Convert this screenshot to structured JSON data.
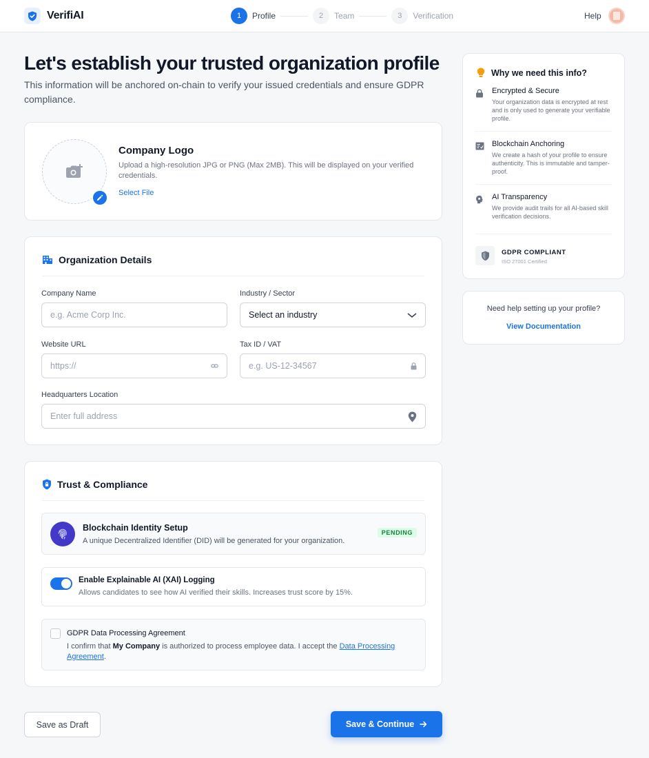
{
  "brand": {
    "name": "VerifiAI"
  },
  "stepper": [
    {
      "num": "1",
      "label": "Profile"
    },
    {
      "num": "2",
      "label": "Team"
    },
    {
      "num": "3",
      "label": "Verification"
    }
  ],
  "header": {
    "help": "Help"
  },
  "hero": {
    "title": "Let's establish your trusted organization profile",
    "subtitle": "This information will be anchored on-chain to verify your issued credentials and ensure GDPR compliance."
  },
  "logo": {
    "title": "Company Logo",
    "description": "Upload a high-resolution JPG or PNG (Max 2MB). This will be displayed on your verified credentials.",
    "link": "Select File"
  },
  "org": {
    "title": "Organization Details",
    "company_name": {
      "label": "Company Name",
      "placeholder": "e.g. Acme Corp Inc."
    },
    "industry": {
      "label": "Industry / Sector",
      "value": "Select an industry"
    },
    "website": {
      "label": "Website URL",
      "placeholder": "https://"
    },
    "tax": {
      "label": "Tax ID / VAT",
      "placeholder": "e.g. US-12-34567"
    },
    "hq": {
      "label": "Headquarters Location",
      "placeholder": "Enter full address"
    }
  },
  "trust": {
    "title": "Trust & Compliance",
    "blockchain": {
      "title": "Blockchain Identity Setup",
      "description": "A unique Decentralized Identifier (DID) will be generated for your organization.",
      "badge": "PENDING"
    },
    "xai": {
      "title": "Enable Explainable AI (XAI) Logging",
      "description": "Allows candidates to see how AI verified their skills. Increases trust score by 15%.",
      "enabled": true
    },
    "gdpr": {
      "title": "GDPR Data Processing Agreement",
      "text_before": "I confirm that ",
      "company": "My Company",
      "text_mid": " is authorized to process employee data. I accept the ",
      "link": "Data Processing Agreement",
      "text_after": ".",
      "checked": false
    }
  },
  "actions": {
    "draft": "Save as Draft",
    "continue": "Save & Continue"
  },
  "info": {
    "title": "Why we need this info?",
    "items": [
      {
        "icon": "lock-icon",
        "title": "Encrypted & Secure",
        "description": "Your organization data is encrypted at rest and is only used to generate your verifiable profile."
      },
      {
        "icon": "ledger-icon",
        "title": "Blockchain Anchoring",
        "description": "We create a hash of your profile to ensure authenticity. This is immutable and tamper-proof."
      },
      {
        "icon": "brain-icon",
        "title": "AI Transparency",
        "description": "We provide audit trails for all AI-based skill verification decisions."
      }
    ],
    "compliance": {
      "title": "GDPR COMPLIANT",
      "subtitle": "ISO 27001 Certified"
    }
  },
  "help_card": {
    "question": "Need help setting up your profile?",
    "link": "View Documentation"
  },
  "colors": {
    "accent": "#1a73e8",
    "badge_bg": "#dcfce7",
    "badge_text": "#15803d",
    "bulb": "#f59e0b"
  }
}
